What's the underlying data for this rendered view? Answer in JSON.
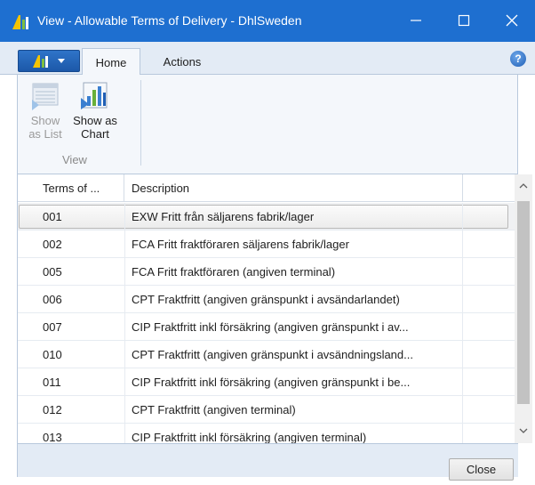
{
  "window": {
    "title": "View - Allowable Terms of Delivery - DhlSweden",
    "minimize_icon": "minimize-icon",
    "maximize_icon": "maximize-icon",
    "close_icon": "close-icon"
  },
  "ribbon": {
    "tabs": [
      {
        "label": "Home",
        "selected": true
      },
      {
        "label": "Actions",
        "selected": false
      }
    ],
    "groups": [
      {
        "label": "View",
        "buttons": [
          {
            "label": "Show as List",
            "line1": "Show",
            "line2": "as List",
            "enabled": false,
            "icon": "list-icon"
          },
          {
            "label": "Show as Chart",
            "line1": "Show as",
            "line2": "Chart",
            "enabled": true,
            "icon": "chart-icon"
          }
        ]
      }
    ],
    "help_icon": "help-icon",
    "help_glyph": "?"
  },
  "grid": {
    "columns": [
      "Terms of ...",
      "Description"
    ],
    "rows": [
      {
        "code": "001",
        "description": "EXW Fritt från säljarens fabrik/lager",
        "selected": true
      },
      {
        "code": "002",
        "description": "FCA Fritt fraktföraren säljarens fabrik/lager",
        "selected": false
      },
      {
        "code": "005",
        "description": "FCA Fritt fraktföraren (angiven terminal)",
        "selected": false
      },
      {
        "code": "006",
        "description": "CPT Fraktfritt (angiven gränspunkt i avsändarlandet)",
        "selected": false
      },
      {
        "code": "007",
        "description": "CIP Fraktfritt inkl försäkring (angiven gränspunkt i av...",
        "selected": false
      },
      {
        "code": "010",
        "description": "CPT Fraktfritt (angiven gränspunkt i avsändningsland...",
        "selected": false
      },
      {
        "code": "011",
        "description": "CIP Fraktfritt inkl försäkring (angiven gränspunkt i be...",
        "selected": false
      },
      {
        "code": "012",
        "description": "CPT Fraktfritt (angiven terminal)",
        "selected": false
      },
      {
        "code": "013",
        "description": "CIP Fraktfritt inkl försäkring (angiven terminal)",
        "selected": false
      }
    ]
  },
  "footer": {
    "close_label": "Close"
  },
  "colors": {
    "titlebar": "#1e6fd0",
    "ribbon_bg": "#f4f7fb",
    "tabstrip_bg": "#e3ebf5",
    "selected_row": "#f0f1f3"
  }
}
